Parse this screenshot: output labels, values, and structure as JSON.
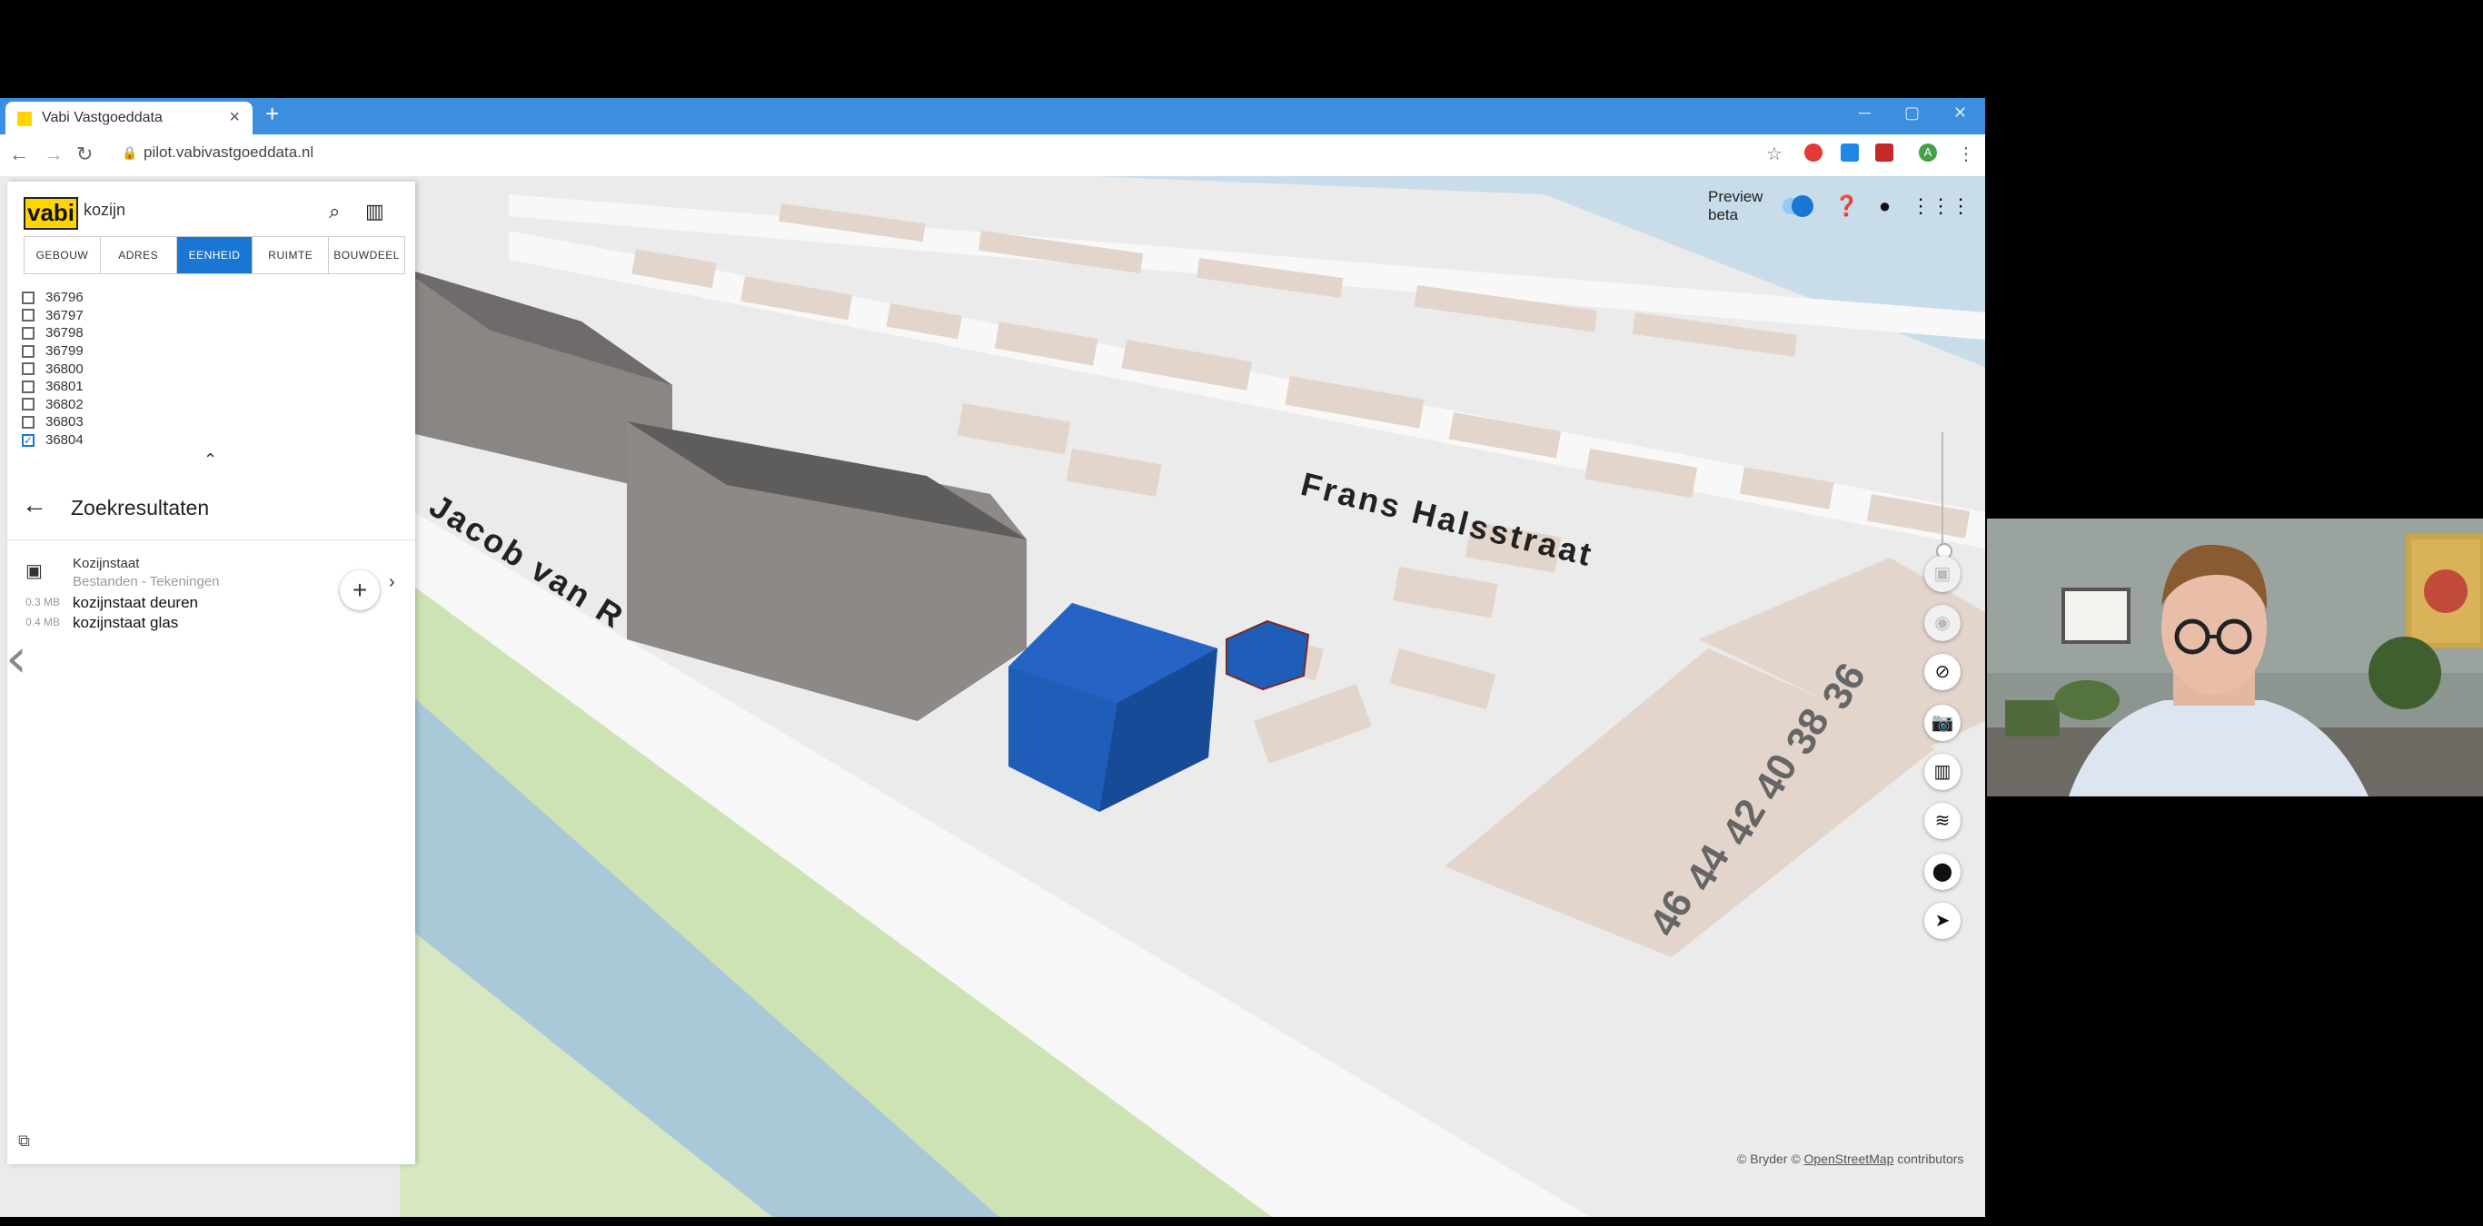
{
  "browser": {
    "tab_title": "Vabi Vastgoeddata",
    "new_tab_icon": "plus-icon",
    "url": "pilot.vabivastgoeddata.nl",
    "profile_initial": "A"
  },
  "sidebar": {
    "logo": "vabi",
    "search_value": "kozijn",
    "tabs": [
      {
        "label": "GEBOUW",
        "active": false
      },
      {
        "label": "ADRES",
        "active": false
      },
      {
        "label": "EENHEID",
        "active": true
      },
      {
        "label": "RUIMTE",
        "active": false
      },
      {
        "label": "BOUWDEEL",
        "active": false
      }
    ],
    "checklist": [
      {
        "label": "36796",
        "checked": false
      },
      {
        "label": "36797",
        "checked": false
      },
      {
        "label": "36798",
        "checked": false
      },
      {
        "label": "36799",
        "checked": false
      },
      {
        "label": "36800",
        "checked": false
      },
      {
        "label": "36801",
        "checked": false
      },
      {
        "label": "36802",
        "checked": false
      },
      {
        "label": "36803",
        "checked": false
      },
      {
        "label": "36804",
        "checked": true
      }
    ],
    "results_title": "Zoekresultaten",
    "result": {
      "name": "Kozijnstaat",
      "category": "Bestanden - Tekeningen",
      "files": [
        {
          "size": "0.3 MB",
          "name": "kozijnstaat deuren"
        },
        {
          "size": "0.4 MB",
          "name": "kozijnstaat glas"
        }
      ]
    }
  },
  "map": {
    "preview_label": "Preview beta",
    "preview_enabled": true,
    "streets": [
      "Frans Halsstraat",
      "Jacob van R"
    ],
    "house_numbers": [
      "36",
      "38",
      "40",
      "42",
      "44",
      "46"
    ],
    "attribution_prefix": "© Bryder ©",
    "attribution_osm": "OpenStreetMap",
    "attribution_suffix": "contributors",
    "colors": {
      "selected_building": "#1e5db8",
      "other_buildings": "#8a8684",
      "water": "#a9c8d8",
      "grass": "#cde3b4"
    }
  }
}
